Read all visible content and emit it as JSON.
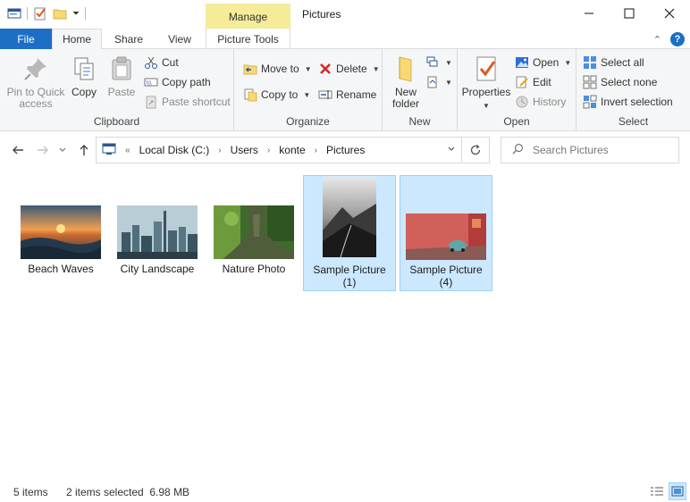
{
  "window": {
    "title": "Pictures",
    "context_tab_group": "Manage",
    "controls": {
      "minimize": "—",
      "maximize": "☐",
      "close": "✕"
    }
  },
  "tabs": {
    "file": "File",
    "home": "Home",
    "share": "Share",
    "view": "View",
    "picture_tools": "Picture Tools"
  },
  "ribbon": {
    "clipboard": {
      "label": "Clipboard",
      "pin_line1": "Pin to Quick",
      "pin_line2": "access",
      "copy": "Copy",
      "paste": "Paste",
      "cut": "Cut",
      "copy_path": "Copy path",
      "paste_shortcut": "Paste shortcut"
    },
    "organize": {
      "label": "Organize",
      "move_to": "Move to",
      "copy_to": "Copy to",
      "delete": "Delete",
      "rename": "Rename"
    },
    "new": {
      "label": "New",
      "new_folder_line1": "New",
      "new_folder_line2": "folder"
    },
    "open": {
      "label": "Open",
      "properties": "Properties",
      "open": "Open",
      "edit": "Edit",
      "history": "History"
    },
    "select": {
      "label": "Select",
      "select_all": "Select all",
      "select_none": "Select none",
      "invert_selection": "Invert selection"
    }
  },
  "address": {
    "prefix": "«",
    "crumbs": [
      "Local Disk (C:)",
      "Users",
      "konte",
      "Pictures"
    ]
  },
  "search": {
    "placeholder": "Search Pictures"
  },
  "files": [
    {
      "name": "Beach Waves",
      "selected": false
    },
    {
      "name": "City Landscape",
      "selected": false
    },
    {
      "name": "Nature Photo",
      "selected": false
    },
    {
      "name": "Sample Picture (1)",
      "selected": true
    },
    {
      "name": "Sample Picture (4)",
      "selected": true
    }
  ],
  "status": {
    "item_count": "5 items",
    "selection": "2 items selected  6.98 MB"
  },
  "colors": {
    "accent": "#1c6fc4",
    "manage_highlight": "#f4ec98",
    "selection_fill": "#cce8ff",
    "selection_border": "#99d1ff"
  }
}
